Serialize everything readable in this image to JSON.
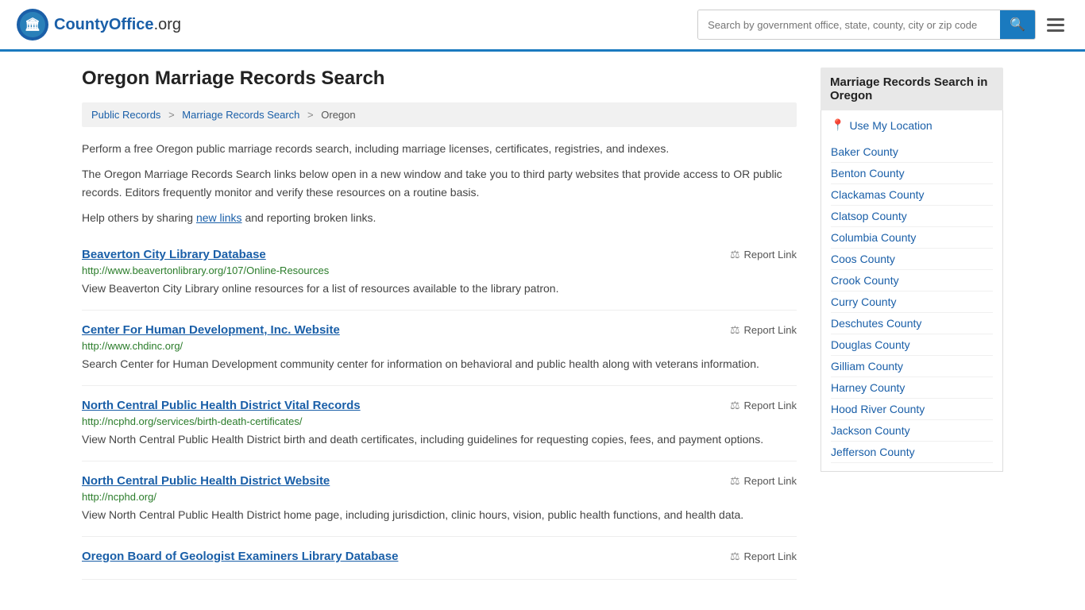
{
  "header": {
    "logo_text": "CountyOffice",
    "logo_org": ".org",
    "search_placeholder": "Search by government office, state, county, city or zip code"
  },
  "page": {
    "title": "Oregon Marriage Records Search",
    "breadcrumb": [
      {
        "label": "Public Records",
        "href": "#"
      },
      {
        "label": "Marriage Records Search",
        "href": "#"
      },
      {
        "label": "Oregon",
        "href": "#"
      }
    ],
    "description1": "Perform a free Oregon public marriage records search, including marriage licenses, certificates, registries, and indexes.",
    "description2": "The Oregon Marriage Records Search links below open in a new window and take you to third party websites that provide access to OR public records. Editors frequently monitor and verify these resources on a routine basis.",
    "description3_pre": "Help others by sharing ",
    "description3_link": "new links",
    "description3_post": " and reporting broken links."
  },
  "results": [
    {
      "title": "Beaverton City Library Database",
      "url": "http://www.beavertonlibrary.org/107/Online-Resources",
      "desc": "View Beaverton City Library online resources for a list of resources available to the library patron.",
      "report": "Report Link"
    },
    {
      "title": "Center For Human Development, Inc. Website",
      "url": "http://www.chdinc.org/",
      "desc": "Search Center for Human Development community center for information on behavioral and public health along with veterans information.",
      "report": "Report Link"
    },
    {
      "title": "North Central Public Health District Vital Records",
      "url": "http://ncphd.org/services/birth-death-certificates/",
      "desc": "View North Central Public Health District birth and death certificates, including guidelines for requesting copies, fees, and payment options.",
      "report": "Report Link"
    },
    {
      "title": "North Central Public Health District Website",
      "url": "http://ncphd.org/",
      "desc": "View North Central Public Health District home page, including jurisdiction, clinic hours, vision, public health functions, and health data.",
      "report": "Report Link"
    },
    {
      "title": "Oregon Board of Geologist Examiners Library Database",
      "url": "",
      "desc": "",
      "report": "Report Link"
    }
  ],
  "sidebar": {
    "header": "Marriage Records Search in Oregon",
    "use_my_location": "Use My Location",
    "counties": [
      "Baker County",
      "Benton County",
      "Clackamas County",
      "Clatsop County",
      "Columbia County",
      "Coos County",
      "Crook County",
      "Curry County",
      "Deschutes County",
      "Douglas County",
      "Gilliam County",
      "Harney County",
      "Hood River County",
      "Jackson County",
      "Jefferson County"
    ]
  }
}
